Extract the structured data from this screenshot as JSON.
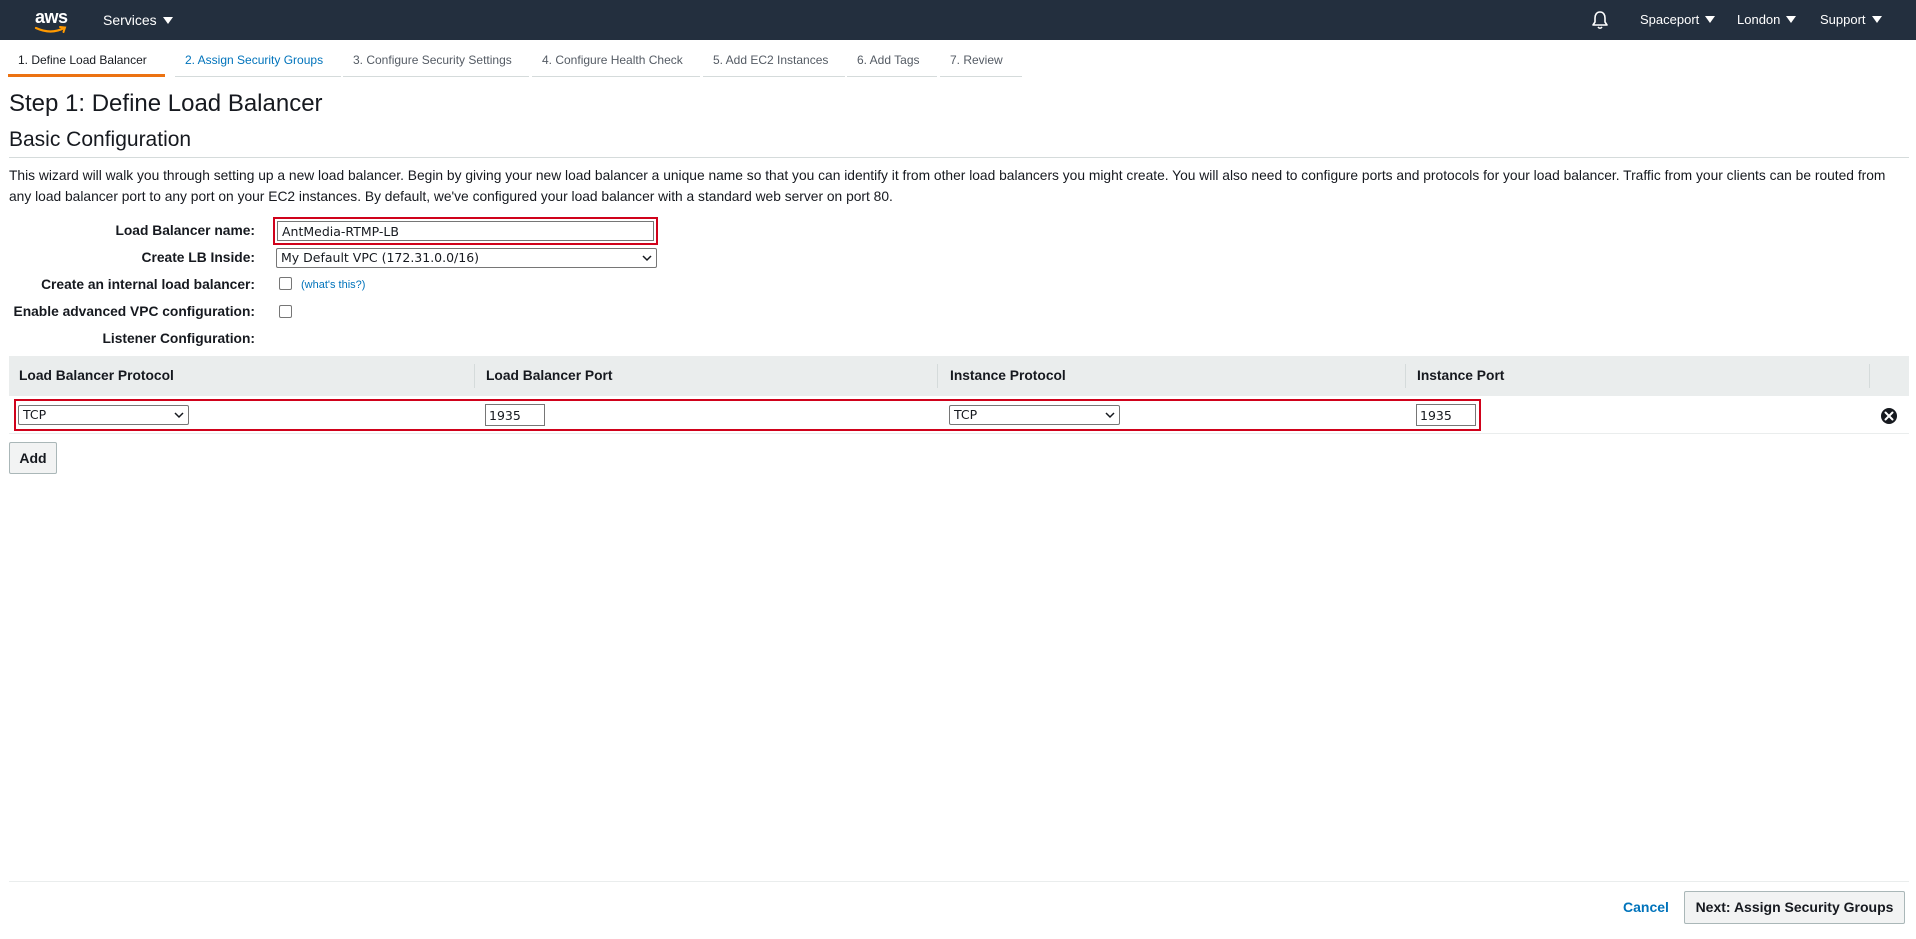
{
  "nav": {
    "brand": "aws",
    "services_label": "Services",
    "account_label": "Spaceport",
    "region_label": "London",
    "support_label": "Support",
    "bg_color": "#232f3e"
  },
  "tabs": [
    {
      "label": "1. Define Load Balancer",
      "state": "active"
    },
    {
      "label": "2. Assign Security Groups",
      "state": "link"
    },
    {
      "label": "3. Configure Security Settings",
      "state": "inactive"
    },
    {
      "label": "4. Configure Health Check",
      "state": "inactive"
    },
    {
      "label": "5. Add EC2 Instances",
      "state": "inactive"
    },
    {
      "label": "6. Add Tags",
      "state": "inactive"
    },
    {
      "label": "7. Review",
      "state": "inactive"
    }
  ],
  "page": {
    "title": "Step 1: Define Load Balancer",
    "section_title": "Basic Configuration",
    "intro": "This wizard will walk you through setting up a new load balancer. Begin by giving your new load balancer a unique name so that you can identify it from other load balancers you might create. You will also need to configure ports and protocols for your load balancer. Traffic from your clients can be routed from any load balancer port to any port on your EC2 instances. By default, we've configured your load balancer with a standard web server on port 80."
  },
  "form": {
    "name_label": "Load Balancer name:",
    "name_value": "AntMedia-RTMP-LB",
    "inside_label": "Create LB Inside:",
    "inside_value": "My Default VPC (172.31.0.0/16)",
    "internal_label": "Create an internal load balancer:",
    "internal_checked": false,
    "whats_this": "(what's this?)",
    "advanced_vpc_label": "Enable advanced VPC configuration:",
    "advanced_vpc_checked": false,
    "listener_label": "Listener Configuration:"
  },
  "listeners": {
    "headers": [
      "Load Balancer Protocol",
      "Load Balancer Port",
      "Instance Protocol",
      "Instance Port"
    ],
    "rows": [
      {
        "lb_protocol": "TCP",
        "lb_port": "1935",
        "instance_protocol": "TCP",
        "instance_port": "1935"
      }
    ],
    "add_label": "Add"
  },
  "footer": {
    "cancel_label": "Cancel",
    "next_label": "Next: Assign Security Groups"
  },
  "colors": {
    "accent": "#ec7211",
    "link": "#0073bb",
    "highlight": "#d0021b"
  }
}
